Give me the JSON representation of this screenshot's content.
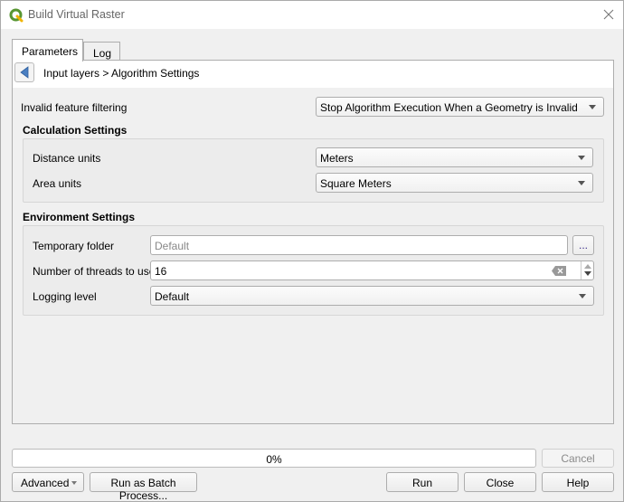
{
  "window": {
    "title": "Build Virtual Raster",
    "logo_icon": "qgis-logo-icon",
    "close_icon": "close-icon"
  },
  "tabs": [
    {
      "label": "Parameters",
      "active": true
    },
    {
      "label": "Log",
      "active": false
    }
  ],
  "breadcrumb": {
    "back_icon": "back-arrow-icon",
    "text": "Input layers > Algorithm Settings"
  },
  "invalid_filtering": {
    "label": "Invalid feature filtering",
    "value": "Stop Algorithm Execution When a Geometry is Invalid"
  },
  "calculation": {
    "title": "Calculation Settings",
    "distance": {
      "label": "Distance units",
      "value": "Meters"
    },
    "area": {
      "label": "Area units",
      "value": "Square Meters"
    }
  },
  "environment": {
    "title": "Environment Settings",
    "temp_folder": {
      "label": "Temporary folder",
      "placeholder": "Default",
      "browse_label": "..."
    },
    "threads": {
      "label": "Number of threads to use",
      "value": "16"
    },
    "logging": {
      "label": "Logging level",
      "value": "Default"
    }
  },
  "progress": {
    "value": 0,
    "label": "0%"
  },
  "buttons": {
    "cancel": "Cancel",
    "advanced": "Advanced",
    "batch": "Run as Batch Process...",
    "run": "Run",
    "close": "Close",
    "help": "Help"
  },
  "colors": {
    "accent_back_arrow": "#4a7fc1",
    "qgis_green": "#589632",
    "qgis_yellow": "#f0b400"
  }
}
